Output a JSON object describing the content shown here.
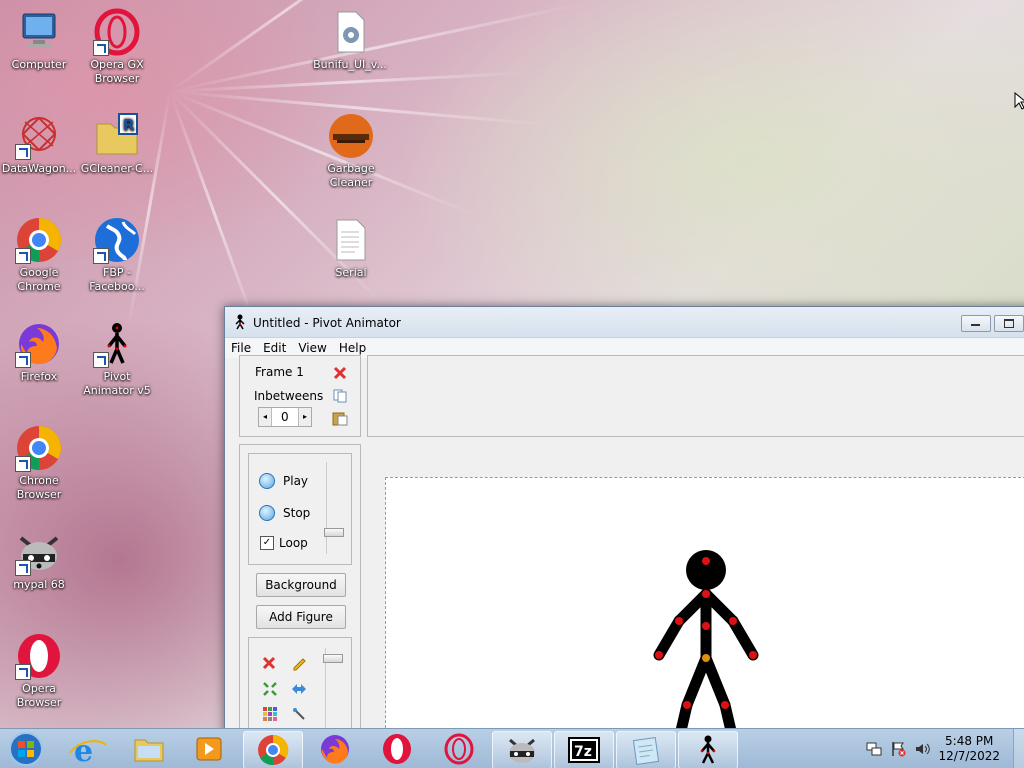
{
  "desktop": {
    "icons": [
      {
        "label": "Computer",
        "icon": "computer-icon",
        "shortcut": false
      },
      {
        "label": "Opera GX Browser",
        "icon": "opera-gx-icon",
        "shortcut": true
      },
      {
        "label": "Bunifu_UI_v...",
        "icon": "settings-file-icon",
        "shortcut": false
      },
      {
        "label": "DataWagon...",
        "icon": "datawagon-icon",
        "shortcut": true
      },
      {
        "label": "GCleaner-C...",
        "icon": "folder-r-icon",
        "shortcut": false
      },
      {
        "label": "Garbage Cleaner",
        "icon": "garbage-cleaner-icon",
        "shortcut": false
      },
      {
        "label": "Google Chrome",
        "icon": "chrome-icon",
        "shortcut": true
      },
      {
        "label": "FBP - Faceboo...",
        "icon": "globe-icon",
        "shortcut": true
      },
      {
        "label": "Serial",
        "icon": "text-file-icon",
        "shortcut": false
      },
      {
        "label": "Firefox",
        "icon": "firefox-icon",
        "shortcut": true
      },
      {
        "label": "Pivot Animator v5",
        "icon": "pivot-icon",
        "shortcut": true
      },
      {
        "label": "Chrone Browser",
        "icon": "chrome-icon",
        "shortcut": true
      },
      {
        "label": "mypal 68",
        "icon": "raccoon-icon",
        "shortcut": true
      },
      {
        "label": "Opera Browser",
        "icon": "opera-icon",
        "shortcut": true
      }
    ]
  },
  "window": {
    "title": "Untitled - Pivot Animator",
    "menu": [
      "File",
      "Edit",
      "View",
      "Help"
    ],
    "frame_label": "Frame 1",
    "inbetweens_label": "Inbetweens",
    "inbetweens_value": "0",
    "play_label": "Play",
    "stop_label": "Stop",
    "loop_label": "Loop",
    "loop_checked": true,
    "background_label": "Background",
    "add_figure_label": "Add Figure"
  },
  "taskbar": {
    "items": [
      "start",
      "internet-explorer",
      "file-explorer",
      "media-player",
      "chrome",
      "firefox",
      "opera",
      "opera-gx",
      "mypal",
      "7zip",
      "notepad",
      "pivot-animator"
    ],
    "time": "5:48 PM",
    "date": "12/7/2022"
  }
}
